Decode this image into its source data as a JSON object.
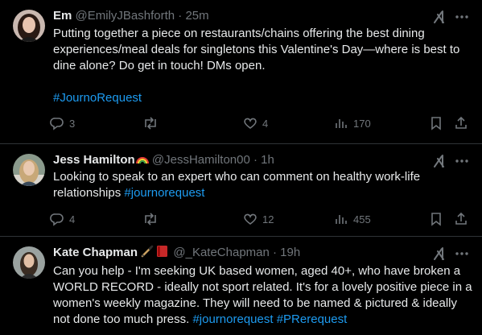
{
  "tweets": [
    {
      "name": "Em",
      "handle": "@EmilyJBashforth",
      "time": "· 25m",
      "text": "Putting together a piece on restaurants/chains offering the best dining experiences/meal deals for singletons this Valentine's Day—where is best to dine alone? Do get in touch! DMs open.",
      "hashtag": "#JournoRequest",
      "replies": "3",
      "retweets": "",
      "likes": "4",
      "views": "170"
    },
    {
      "name": "Jess Hamilton",
      "name_emoji": "rainbow-emoji",
      "handle": "@JessHamilton00",
      "time": "· 1h",
      "text": "Looking to speak to an expert who can comment on healthy work-life relationships",
      "hashtag": "#journorequest",
      "replies": "4",
      "retweets": "",
      "likes": "12",
      "views": "455"
    },
    {
      "name": "Kate Chapman",
      "name_emoji": "pen-and-book-emoji",
      "handle": "@_KateChapman",
      "time": "· 19h",
      "text": "Can you help  - I'm seeking UK based women, aged 40+, who have broken a WORLD RECORD - ideally not sport related. It's for a lovely positive piece in a women's weekly magazine. They will need to be named & pictured & ideally not done too much press.",
      "hashtag": "#journorequest",
      "hashtag2": "#PRerequest"
    }
  ],
  "colors": {
    "background": "#000000",
    "text": "#e7e9ea",
    "muted": "#71767b",
    "accent": "#1d9bf0",
    "divider": "#2f3336"
  }
}
